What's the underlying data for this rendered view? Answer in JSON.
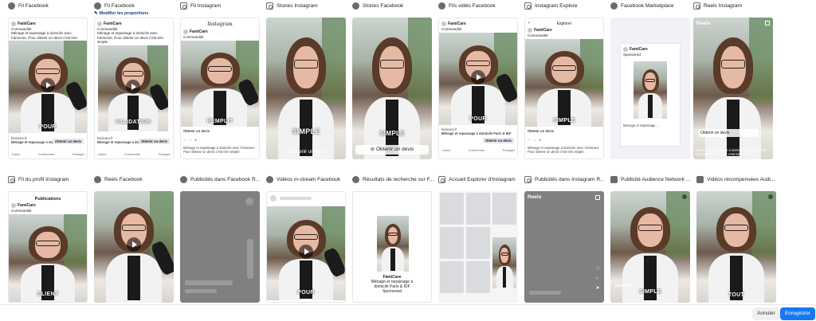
{
  "row1": [
    {
      "title": "Fil Facebook",
      "icon": "facebook-icon"
    },
    {
      "title": "Fil Facebook",
      "icon": "facebook-icon"
    },
    {
      "title": "Fil Instagram",
      "icon": "instagram-icon"
    },
    {
      "title": "Stories Instagram",
      "icon": "instagram-icon"
    },
    {
      "title": "Stories Facebook",
      "icon": "facebook-icon"
    },
    {
      "title": "Fils vidéo Facebook",
      "icon": "facebook-icon"
    },
    {
      "title": "Instagram Explore",
      "icon": "instagram-icon"
    },
    {
      "title": "Facebook Marketplace",
      "icon": "facebook-icon"
    },
    {
      "title": "Reels Instagram",
      "icon": "instagram-icon"
    }
  ],
  "row2": [
    {
      "title": "Fil du profil Instagram",
      "icon": "instagram-icon"
    },
    {
      "title": "Reels Facebook",
      "icon": "facebook-icon"
    },
    {
      "title": "Publicités dans Facebook R...",
      "icon": "facebook-icon"
    },
    {
      "title": "Vidéos in-stream Facebook",
      "icon": "facebook-icon"
    },
    {
      "title": "Résultats de recherche sur F...",
      "icon": "facebook-icon"
    },
    {
      "title": "Accueil Explorer d'Instagram",
      "icon": "instagram-icon"
    },
    {
      "title": "Publicités dans Instagram R...",
      "icon": "instagram-icon"
    },
    {
      "title": "Publicité Audience Network ...",
      "icon": "meta-icon"
    },
    {
      "title": "Vidéos récompensées Audi...",
      "icon": "meta-icon"
    }
  ],
  "edit_proportions": "Modifier les proportions",
  "brand": "FamiCare",
  "sponsored": "Commandité",
  "sponsored_en": "Sponsored",
  "ad_text": "Ménage et repassage à domicile avec Famicare. Pour obtenir un devis c'est très simple.",
  "see_more": "Voir plus",
  "link_domain": "famicare.fr",
  "link_title": "Ménage et repassage à domicile Paris & IDF",
  "cta": "Obtenir un devis",
  "cta_story": "Obtenir un devis",
  "like": "J'aime",
  "comment": "Commenter",
  "share": "Partager",
  "captions": {
    "fb1": "POUR",
    "fb2": "VALIDATION",
    "ig_feed": "REMPLIT",
    "ig_story": "SIMPLE",
    "fb_story": "SIMPLE",
    "fb_video": "POUR",
    "ig_explore": "SIMPLE",
    "ig_profile": "CLIENT",
    "fb_instream": "POUR",
    "an_1": "SIMPLE",
    "an_2": "TOUT"
  },
  "ig_logo": "Instagram",
  "explore_header": "Explorer",
  "publications": "Publications",
  "marketplace_brand": "FamiCare",
  "marketplace_text": "Ménage et repassage ...",
  "search_brand": "FamiCare",
  "search_text": "Ménage et repassage à domicile Paris & IDF",
  "reels": "Reels",
  "famicare_short": "FamiCare",
  "cancel": "Annuler",
  "save": "Enregistrer"
}
